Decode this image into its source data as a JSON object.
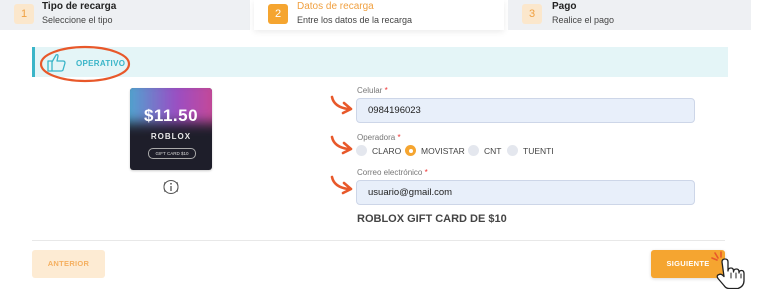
{
  "stepper": {
    "steps": [
      {
        "number": "1",
        "title": "Tipo de recarga",
        "subtitle": "Seleccione el tipo"
      },
      {
        "number": "2",
        "title": "Datos de recarga",
        "subtitle": "Entre los datos de la recarga"
      },
      {
        "number": "3",
        "title": "Pago",
        "subtitle": "Realice el pago"
      }
    ],
    "active_step": 2
  },
  "status": {
    "label": "OPERATIVO",
    "icon": "thumbs-up-icon"
  },
  "gift_card": {
    "amount": "$11.50",
    "brand": "ROBLOX",
    "card_label": "GIFT CARD $10"
  },
  "form": {
    "phone": {
      "label": "Celular",
      "required_mark": "*",
      "value": "0984196023"
    },
    "operator": {
      "label": "Operadora",
      "required_mark": "*",
      "options": [
        "CLARO",
        "MOVISTAR",
        "CNT",
        "TUENTI"
      ],
      "selected": "MOVISTAR"
    },
    "email": {
      "label": "Correo electrónico",
      "required_mark": "*",
      "value": "usuario@gmail.com"
    },
    "product_name": "ROBLOX GIFT CARD DE $10"
  },
  "buttons": {
    "previous": "ANTERIOR",
    "next": "SIGUIENTE"
  },
  "colors": {
    "accent": "#f5a530",
    "status": "#3ab5c8",
    "annotation": "#e8582a"
  }
}
